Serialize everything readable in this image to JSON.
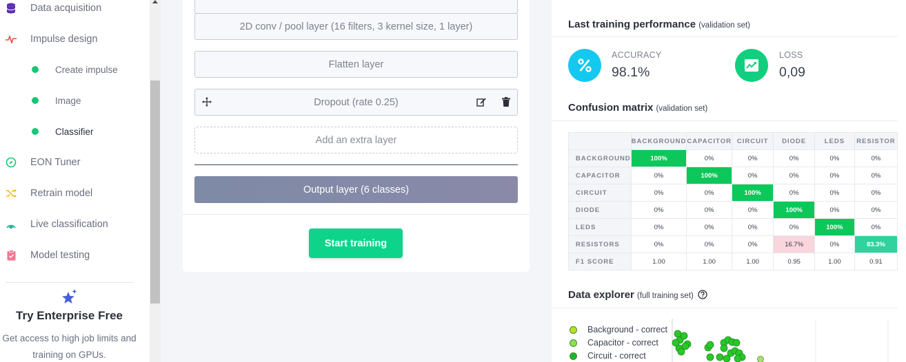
{
  "sidebar": {
    "items": [
      {
        "label": "Data acquisition",
        "icon": "database-icon"
      },
      {
        "label": "Impulse design",
        "icon": "pulse-icon"
      },
      {
        "label": "EON Tuner",
        "icon": "compass-icon"
      },
      {
        "label": "Retrain model",
        "icon": "shuffle-icon"
      },
      {
        "label": "Live classification",
        "icon": "signal-icon"
      },
      {
        "label": "Model testing",
        "icon": "clipboard-check-icon"
      }
    ],
    "sub_items": [
      {
        "label": "Create impulse"
      },
      {
        "label": "Image"
      },
      {
        "label": "Classifier"
      }
    ],
    "enterprise": {
      "title": "Try Enterprise Free",
      "text": "Get access to high job limits and training on GPUs."
    }
  },
  "nn": {
    "layers": [
      {
        "label": "2D conv / pool layer (16 filters, 3 kernel size, 1 layer)"
      },
      {
        "label": "Flatten layer"
      },
      {
        "label": "Dropout (rate 0.25)"
      },
      {
        "label": "Add an extra layer"
      }
    ],
    "output_layer": "Output layer (6 classes)",
    "start_training": "Start training"
  },
  "performance": {
    "title": "Last training performance",
    "subtitle": "(validation set)",
    "accuracy_label": "ACCURACY",
    "accuracy_value": "98.1%",
    "loss_label": "LOSS",
    "loss_value": "0,09"
  },
  "confusion": {
    "title": "Confusion matrix",
    "subtitle": "(validation set)",
    "columns": [
      "BACKGROUND",
      "CAPACITOR",
      "CIRCUIT",
      "DIODE",
      "LEDS",
      "RESISTOR"
    ],
    "rows": [
      {
        "label": "BACKGROUND",
        "cells": [
          "100%",
          "0%",
          "0%",
          "0%",
          "0%",
          "0%"
        ]
      },
      {
        "label": "CAPACITOR",
        "cells": [
          "0%",
          "100%",
          "0%",
          "0%",
          "0%",
          "0%"
        ]
      },
      {
        "label": "CIRCUIT",
        "cells": [
          "0%",
          "0%",
          "100%",
          "0%",
          "0%",
          "0%"
        ]
      },
      {
        "label": "DIODE",
        "cells": [
          "0%",
          "0%",
          "0%",
          "100%",
          "0%",
          "0%"
        ]
      },
      {
        "label": "LEDS",
        "cells": [
          "0%",
          "0%",
          "0%",
          "0%",
          "100%",
          "0%"
        ]
      },
      {
        "label": "RESISTORS",
        "cells": [
          "0%",
          "0%",
          "0%",
          "16.7%",
          "0%",
          "83.3%"
        ]
      }
    ],
    "f1_label": "F1 SCORE",
    "f1": [
      "1.00",
      "1.00",
      "1.00",
      "0.95",
      "1.00",
      "0.91"
    ]
  },
  "explorer": {
    "title": "Data explorer",
    "subtitle": "(full training set)",
    "legend": [
      {
        "label": "Background - correct",
        "color": "#b5e61d"
      },
      {
        "label": "Capacitor - correct",
        "color": "#8ee05a"
      },
      {
        "label": "Circuit - correct",
        "color": "#19b82a"
      }
    ]
  },
  "colors": {
    "accent_green": "#0ed48b",
    "accuracy_blue": "#14c8f0",
    "loss_green": "#12cf7f"
  }
}
